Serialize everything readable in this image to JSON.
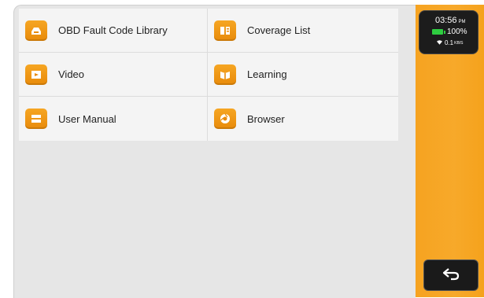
{
  "menu": {
    "items": [
      {
        "label": "OBD Fault Code Library",
        "icon": "fault-code-library-icon"
      },
      {
        "label": "Coverage List",
        "icon": "coverage-list-icon"
      },
      {
        "label": "Video",
        "icon": "video-icon"
      },
      {
        "label": "Learning",
        "icon": "learning-icon"
      },
      {
        "label": "User Manual",
        "icon": "user-manual-icon"
      },
      {
        "label": "Browser",
        "icon": "browser-icon"
      }
    ]
  },
  "status": {
    "time": "03:56",
    "ampm": "PM",
    "battery": "100%",
    "net_speed": "0.1",
    "net_unit": "KB/S"
  },
  "colors": {
    "accent": "#f6a21f",
    "icon_bg": "#f29a16",
    "battery": "#2ecc40"
  }
}
